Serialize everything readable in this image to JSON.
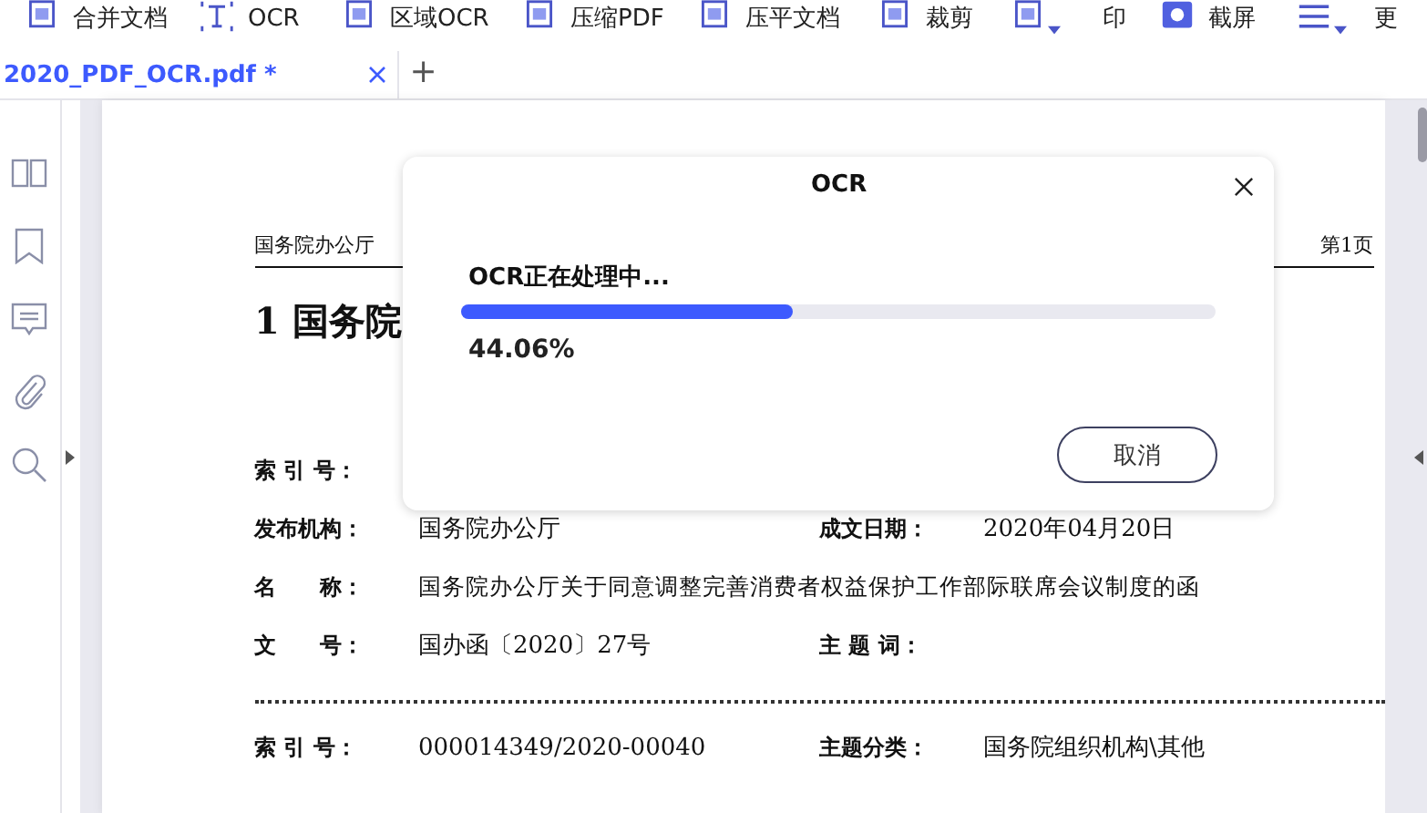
{
  "toolbar": [
    {
      "label": "合并文档",
      "kind": "button"
    },
    {
      "label": "OCR",
      "kind": "button"
    },
    {
      "label": "区域OCR",
      "kind": "button"
    },
    {
      "label": "压缩PDF",
      "kind": "button"
    },
    {
      "label": "压平文档",
      "kind": "button"
    },
    {
      "label": "裁剪",
      "kind": "button"
    },
    {
      "kind": "dropdown"
    },
    {
      "label": "印",
      "kind": "button"
    },
    {
      "label": "截屏",
      "kind": "button"
    },
    {
      "kind": "dropdown"
    },
    {
      "label": "更",
      "kind": "button"
    }
  ],
  "tabs": [
    {
      "label": "2020_PDF_OCR.pdf *",
      "selected": true
    }
  ],
  "new_tab": "+",
  "document": {
    "header_left": "国务院办公厅",
    "header_right": "第1页",
    "title": "1 国务院",
    "rows": [
      {
        "cells": [
          {
            "kind": "label",
            "text": "索 引 号："
          }
        ]
      },
      {
        "cells": [
          {
            "kind": "label",
            "text": "发布机构："
          },
          {
            "kind": "value",
            "text": "国务院办公厅"
          },
          {
            "kind": "label",
            "text": "成文日期："
          },
          {
            "kind": "value",
            "text": "2020年04月20日"
          }
        ]
      },
      {
        "cells": [
          {
            "kind": "label",
            "text": "名　　称："
          },
          {
            "kind": "wide",
            "text": "国务院办公厅关于同意调整完善消费者权益保护工作部际联席会议制度的函"
          }
        ]
      },
      {
        "cells": [
          {
            "kind": "label",
            "text": "文　　号："
          },
          {
            "kind": "value",
            "text": "国办函〔2020〕27号"
          },
          {
            "kind": "label",
            "text": "主 题 词："
          }
        ]
      }
    ],
    "rows_after_rule": [
      {
        "cells": [
          {
            "kind": "label",
            "text": "索 引 号："
          },
          {
            "kind": "value",
            "text": "000014349/2020-00040"
          },
          {
            "kind": "label",
            "text": "主题分类："
          },
          {
            "kind": "value",
            "text": "国务院组织机构\\其他"
          }
        ]
      }
    ]
  },
  "dialog": {
    "title": "OCR",
    "status": "OCR正在处理中...",
    "level": 0.44,
    "percent": "44.06%",
    "cancel": "取消"
  }
}
